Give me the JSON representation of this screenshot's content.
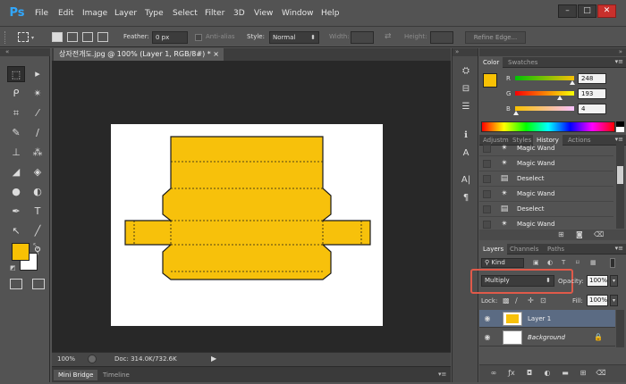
{
  "app": {
    "logo": "Ps"
  },
  "menu": [
    "File",
    "Edit",
    "Image",
    "Layer",
    "Type",
    "Select",
    "Filter",
    "3D",
    "View",
    "Window",
    "Help"
  ],
  "window_controls": {
    "minimize": "–",
    "maximize": "□",
    "close": "✕"
  },
  "options_bar": {
    "feather_label": "Feather:",
    "feather_value": "0 px",
    "antialias_label": "Anti-alias",
    "style_label": "Style:",
    "style_value": "Normal",
    "width_label": "Width:",
    "height_label": "Height:",
    "refine_edge": "Refine Edge..."
  },
  "document": {
    "tab_title": "상자전개도.jpg @ 100% (Layer 1, RGB/8#) *",
    "tab_close": "×",
    "zoom": "100%",
    "doc_size": "Doc: 314.0K/732.6K",
    "shape_color": "#f7c10b",
    "bottom_tabs": [
      "Mini Bridge",
      "Timeline"
    ]
  },
  "color_panel": {
    "tabs": [
      "Color",
      "Swatches"
    ],
    "r_label": "R",
    "r_value": "248",
    "g_label": "G",
    "g_value": "193",
    "b_label": "B",
    "b_value": "4",
    "r_fraction": 0.973,
    "g_fraction": 0.757,
    "b_fraction": 0.016,
    "foreground": "#f8c104",
    "background": "#ffffff"
  },
  "history_panel": {
    "tabs": [
      "Adjustm",
      "Styles",
      "History",
      "Actions"
    ],
    "items": [
      {
        "label": "Magic Wand",
        "icon": "magic-wand-icon"
      },
      {
        "label": "Magic Wand",
        "icon": "magic-wand-icon"
      },
      {
        "label": "Deselect",
        "icon": "deselect-icon"
      },
      {
        "label": "Magic Wand",
        "icon": "magic-wand-icon"
      },
      {
        "label": "Deselect",
        "icon": "deselect-icon"
      },
      {
        "label": "Magic Wand",
        "icon": "magic-wand-icon"
      }
    ]
  },
  "layers_panel": {
    "tabs": [
      "Layers",
      "Channels",
      "Paths"
    ],
    "kind_label": "Kind",
    "blend_mode": "Multiply",
    "opacity_label": "Opacity:",
    "opacity_value": "100%",
    "lock_label": "Lock:",
    "fill_label": "Fill:",
    "fill_value": "100%",
    "layers": [
      {
        "name": "Layer 1",
        "selected": true
      },
      {
        "name": "Background",
        "selected": false,
        "locked": true
      }
    ],
    "highlight_color": "#e05a4a"
  }
}
